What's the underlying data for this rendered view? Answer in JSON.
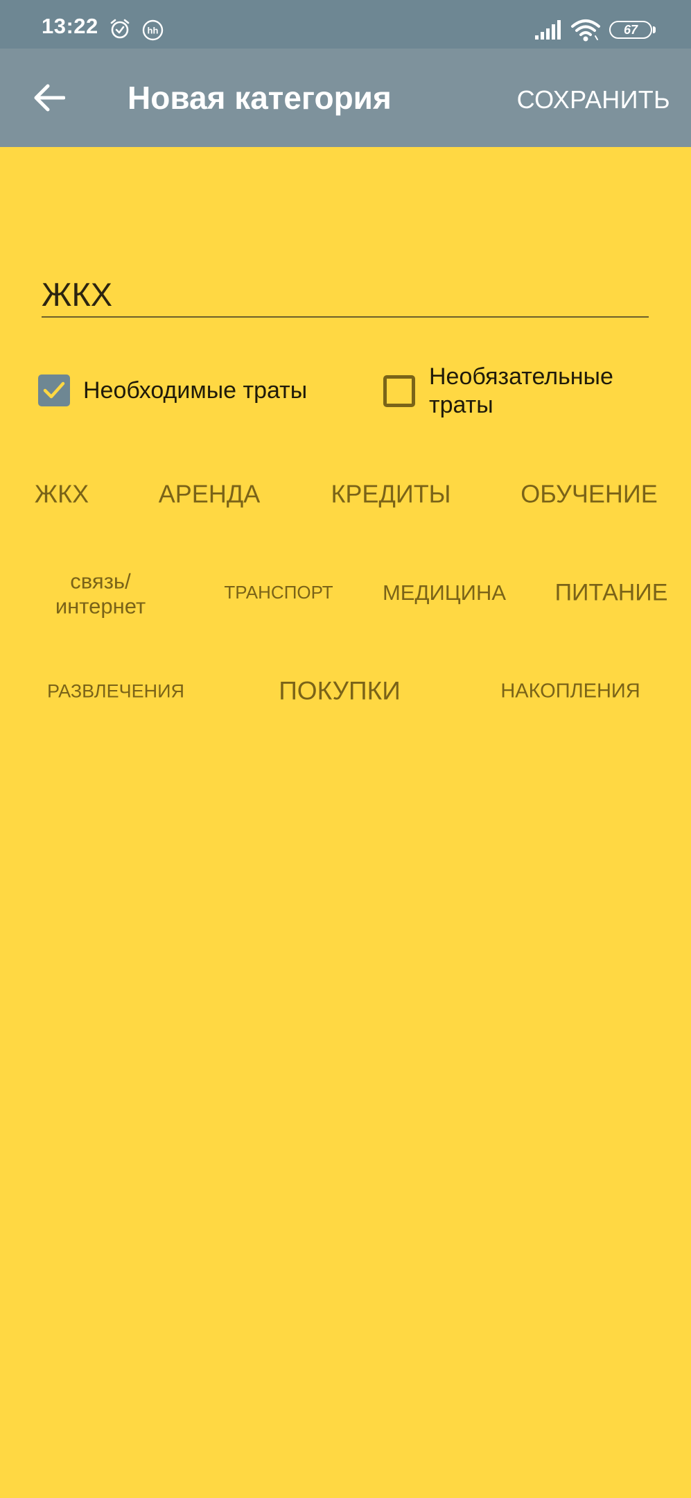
{
  "status_bar": {
    "time": "13:22",
    "icons": [
      "alarm-icon",
      "hh-icon",
      "cell-signal-icon",
      "wifi-icon",
      "battery-icon"
    ],
    "battery_level": "67"
  },
  "toolbar": {
    "back_icon": "arrow-left-icon",
    "title": "Новая категория",
    "save_label": "СОХРАНИТЬ"
  },
  "form": {
    "name_value": "ЖКХ",
    "name_placeholder": ""
  },
  "checkboxes": {
    "required": {
      "label": "Необходимые траты",
      "checked": true
    },
    "optional": {
      "label": "Необязательные траты",
      "checked": false
    }
  },
  "chips": [
    "ЖКХ",
    "АРЕНДА",
    "КРЕДИТЫ",
    "ОБУЧЕНИЕ",
    "связь/ интернет",
    "ТРАНСПОРТ",
    "МЕДИЦИНА",
    "ПИТАНИЕ",
    "РАЗВЛЕЧЕНИЯ",
    "ПОКУПКИ",
    "НАКОПЛЕНИЯ"
  ],
  "colors": {
    "background": "#FFD843",
    "toolbar": "#7E929C",
    "status_bar": "#6E8793",
    "chip_text": "#7A6318",
    "checkbox_checked": "#6E8793"
  }
}
